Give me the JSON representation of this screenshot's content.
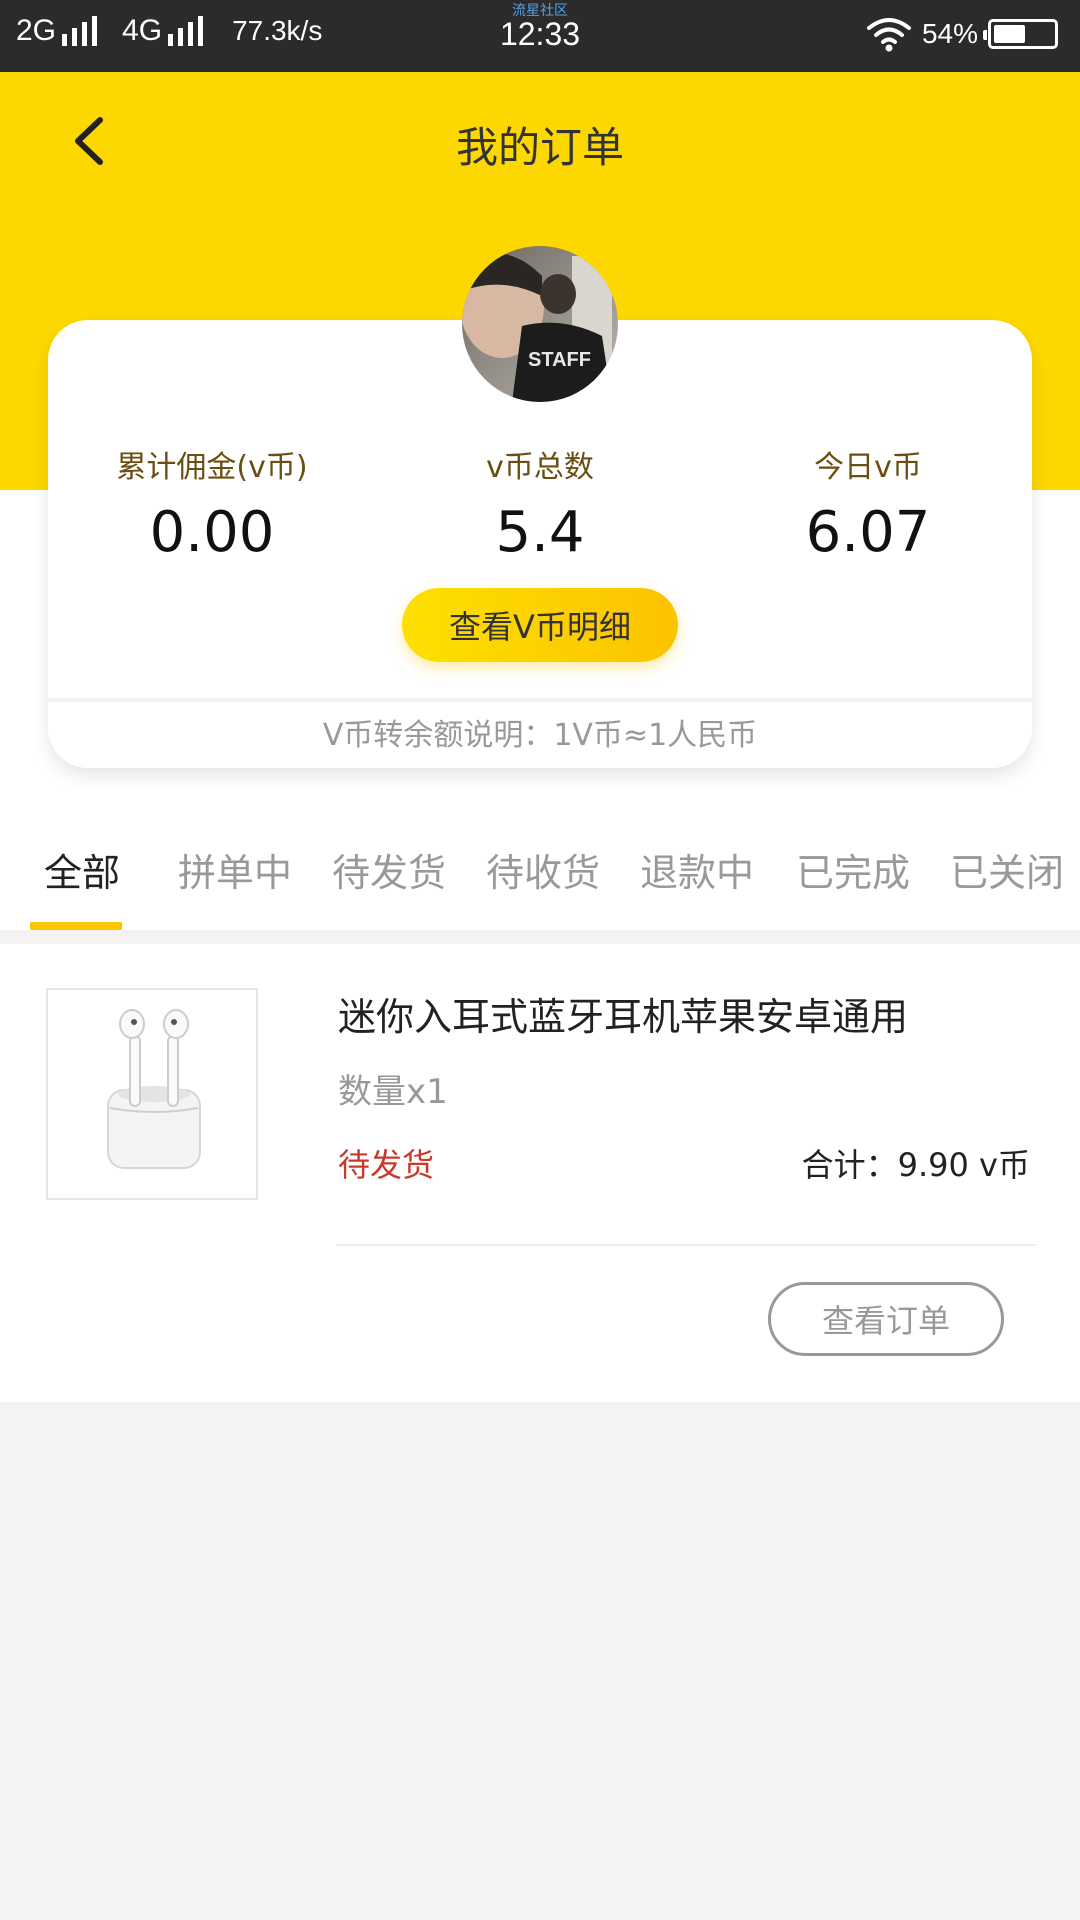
{
  "status_bar": {
    "network1": "2G",
    "network2": "4G",
    "speed": "77.3k/s",
    "carrier_tag": "流星社区",
    "time": "12:33",
    "battery_percent": "54%",
    "battery_level": 0.54
  },
  "header": {
    "title": "我的订单",
    "back_icon": "chevron-left-icon"
  },
  "summary": {
    "stats": [
      {
        "label": "累计佣金(v币)",
        "value": "0.00"
      },
      {
        "label": "v币总数",
        "value": "5.4"
      },
      {
        "label": "今日v币",
        "value": "6.07"
      }
    ],
    "detail_button": "查看V币明细",
    "note": "V币转余额说明：1V币≈1人民币"
  },
  "tabs": [
    "全部",
    "拼单中",
    "待发货",
    "待收货",
    "退款中",
    "已完成",
    "已关闭"
  ],
  "active_tab": 0,
  "order": {
    "product_name": "迷你入耳式蓝牙耳机苹果安卓通用",
    "quantity": "数量x1",
    "status": "待发货",
    "total": "合计：9.90 v币",
    "view_button": "查看订单"
  },
  "colors": {
    "brand_yellow": "#fdd800",
    "status_red": "#c9392b",
    "tab_indicator": "#fdc400"
  }
}
